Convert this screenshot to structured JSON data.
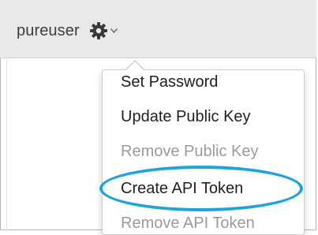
{
  "user_menu": {
    "username": "pureuser",
    "settings_icon": "gear-icon",
    "caret_icon": "caret-down-icon"
  },
  "dropdown": {
    "items": [
      {
        "label": "Set Password",
        "enabled": true
      },
      {
        "label": "Update Public Key",
        "enabled": true
      },
      {
        "label": "Remove Public Key",
        "enabled": false
      },
      {
        "label": "Create API Token",
        "enabled": true,
        "highlighted": true
      },
      {
        "label": "Remove API Token",
        "enabled": false
      }
    ]
  },
  "colors": {
    "header_background": "#e9e9e9",
    "enabled_text": "#1f1f1f",
    "disabled_text": "#9a9a9a",
    "highlight": "#1fa3dc",
    "gear": "#3a3a3a"
  }
}
